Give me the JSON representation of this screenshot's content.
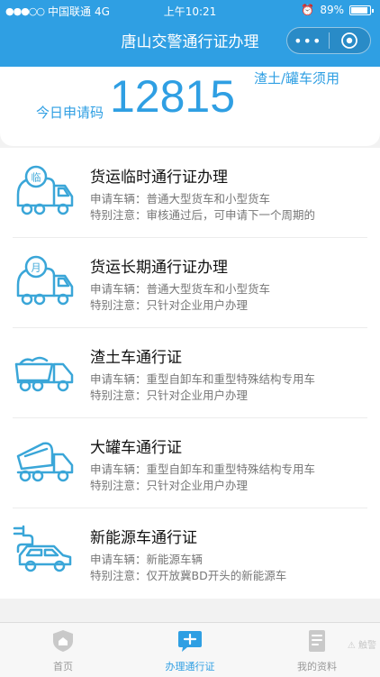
{
  "status_bar": {
    "dots": "●●●○○",
    "carrier": "中国联通",
    "network": "4G",
    "time": "上午10:21",
    "alarm": "⏰",
    "battery": "89%",
    "battery_level": 0.89
  },
  "nav": {
    "title": "唐山交警通行证办理",
    "more": "•••",
    "target_icon": "target-icon"
  },
  "counter": {
    "label": "今日申请码",
    "value": "12815",
    "note": "渣土/罐车须用"
  },
  "permits": [
    {
      "title": "货运临时通行证办理",
      "vehicle_label": "申请车辆：",
      "vehicle": "普通大型货车和小型货车",
      "note_label": "特别注意：",
      "note": "审核通过后，可申请下一个周期的",
      "icon": "truck-temp-icon",
      "badge": "临"
    },
    {
      "title": "货运长期通行证办理",
      "vehicle_label": "申请车辆：",
      "vehicle": "普通大型货车和小型货车",
      "note_label": "特别注意：",
      "note": "只针对企业用户办理",
      "icon": "truck-long-icon",
      "badge": "月"
    },
    {
      "title": "渣土车通行证",
      "vehicle_label": "申请车辆：",
      "vehicle": "重型自卸车和重型特殊结构专用车",
      "note_label": "特别注意：",
      "note": "只针对企业用户办理",
      "icon": "dump-truck-icon"
    },
    {
      "title": "大罐车通行证",
      "vehicle_label": "申请车辆：",
      "vehicle": "重型自卸车和重型特殊结构专用车",
      "note_label": "特别注意：",
      "note": "只针对企业用户办理",
      "icon": "mixer-truck-icon"
    },
    {
      "title": "新能源车通行证",
      "vehicle_label": "申请车辆：",
      "vehicle": "新能源车辆",
      "note_label": "特别注意：",
      "note": "仅开放冀BD开头的新能源车",
      "icon": "electric-car-icon"
    }
  ],
  "tabs": [
    {
      "label": "首页",
      "icon": "shield-home-icon"
    },
    {
      "label": "办理通行证",
      "icon": "chat-plus-icon"
    },
    {
      "label": "我的资料",
      "icon": "document-icon"
    }
  ],
  "watermark": "⚠ 触警",
  "colors": {
    "primary": "#2f9fe3",
    "icon_blue": "#3aa6d8",
    "text_gray": "#777777",
    "tab_inactive": "#9a9a9a"
  }
}
